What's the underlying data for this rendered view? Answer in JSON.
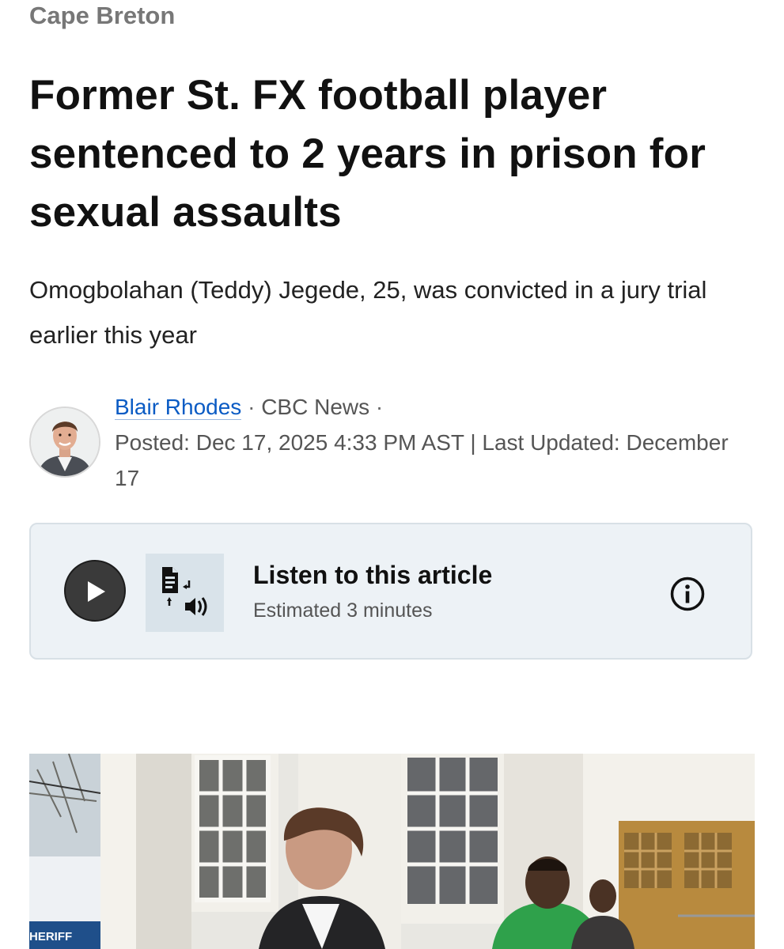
{
  "article": {
    "section": "Cape Breton",
    "headline": "Former St. FX football player sentenced to 2 years in prison for sexual assaults",
    "deck": "Omogbolahan (Teddy) Jegede, 25, was convicted in a jury trial earlier this year"
  },
  "byline": {
    "author": "Blair Rhodes",
    "separator": "·",
    "outlet": "CBC News",
    "posted": "Posted: Dec 17, 2025 4:33 PM AST | Last Updated: December 17"
  },
  "listen": {
    "title": "Listen to this article",
    "subtitle": "Estimated 3 minutes",
    "play_icon": "play-icon",
    "tts_icon": "text-to-speech-icon",
    "info_icon": "info-icon"
  },
  "hero": {
    "vehicle_text": "HERIFF"
  },
  "colors": {
    "link": "#0a5bc4",
    "card_background": "#edf2f6",
    "play_button": "#3a3a3a"
  }
}
